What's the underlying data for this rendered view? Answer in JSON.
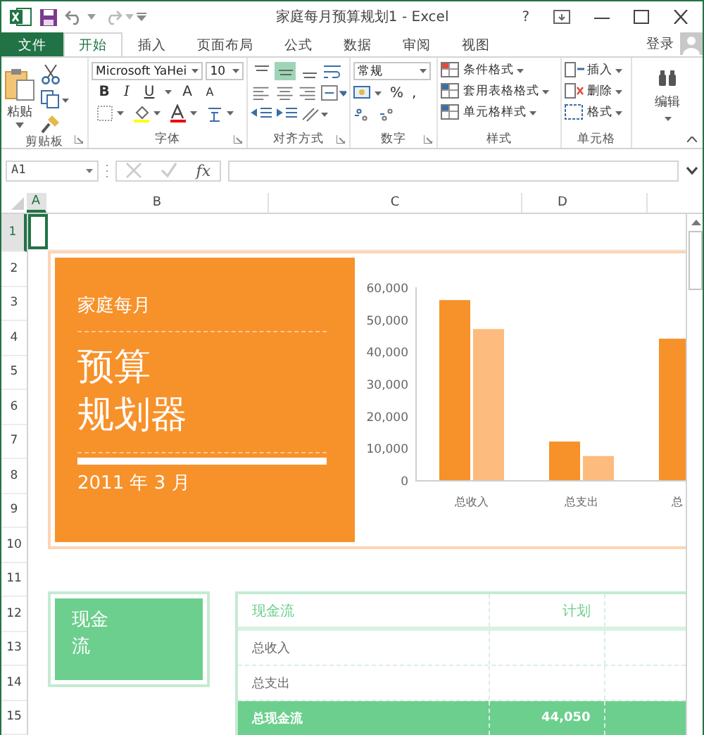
{
  "window": {
    "title": "家庭每月预算规划1 - Excel",
    "help": "?"
  },
  "tabs": [
    {
      "label": "文件",
      "kind": "file",
      "selected": false
    },
    {
      "label": "开始",
      "kind": "tab",
      "selected": true
    },
    {
      "label": "插入",
      "kind": "tab",
      "selected": false
    },
    {
      "label": "页面布局",
      "kind": "tab",
      "selected": false
    },
    {
      "label": "公式",
      "kind": "tab",
      "selected": false
    },
    {
      "label": "数据",
      "kind": "tab",
      "selected": false
    },
    {
      "label": "审阅",
      "kind": "tab",
      "selected": false
    },
    {
      "label": "视图",
      "kind": "tab",
      "selected": false
    }
  ],
  "account": "登录",
  "ribbon": {
    "paste": "粘贴",
    "font_name": "Microsoft YaHei",
    "font_size": "10",
    "font_buttons": [
      "B",
      "I",
      "U"
    ],
    "grow_shrink": [
      "A",
      "A"
    ],
    "vertical_align": [
      {
        "selected": false
      },
      {
        "selected": true
      },
      {
        "selected": false
      }
    ],
    "number_format": "常规",
    "number_symbols": [
      "%",
      ","
    ],
    "styles": [
      "条件格式",
      "套用表格格式",
      "单元格样式"
    ],
    "cells": [
      "插入",
      "删除",
      "格式"
    ],
    "edit": "编辑",
    "groups": [
      "剪贴板",
      "字体",
      "对齐方式",
      "数字",
      "样式",
      "单元格"
    ]
  },
  "formula_bar": {
    "name_box": "A1",
    "fx": "fx"
  },
  "columns": [
    {
      "label": "A",
      "selected": true
    },
    {
      "label": "B",
      "selected": false
    },
    {
      "label": "C",
      "selected": false
    },
    {
      "label": "D",
      "selected": false
    }
  ],
  "rows": [
    {
      "label": "1",
      "selected": true
    },
    {
      "label": "2",
      "selected": false
    },
    {
      "label": "3",
      "selected": false
    },
    {
      "label": "4",
      "selected": false
    },
    {
      "label": "5",
      "selected": false
    },
    {
      "label": "6",
      "selected": false
    },
    {
      "label": "7",
      "selected": false
    },
    {
      "label": "8",
      "selected": false
    },
    {
      "label": "9",
      "selected": false
    },
    {
      "label": "10",
      "selected": false
    },
    {
      "label": "11",
      "selected": false
    },
    {
      "label": "12",
      "selected": false
    },
    {
      "label": "13",
      "selected": false
    },
    {
      "label": "14",
      "selected": false
    },
    {
      "label": "15",
      "selected": false
    }
  ],
  "title_card": {
    "subtitle": "家庭每月",
    "title_lines": [
      "预算",
      "规划器"
    ],
    "date": "2011 年 3 月"
  },
  "chart_data": {
    "type": "bar",
    "categories": [
      "总收入",
      "总支出",
      "总"
    ],
    "series": [
      {
        "color": "#f7912a",
        "values": [
          56000,
          12000,
          44000
        ]
      },
      {
        "color": "#fdbb7d",
        "values": [
          47000,
          7500,
          null
        ]
      }
    ],
    "ylim": [
      0,
      60000
    ],
    "yticks": [
      {
        "value": 0,
        "label": "0"
      },
      {
        "value": 10000,
        "label": "10,000"
      },
      {
        "value": 20000,
        "label": "20,000"
      },
      {
        "value": 30000,
        "label": "30,000"
      },
      {
        "value": 40000,
        "label": "40,000"
      },
      {
        "value": 50000,
        "label": "50,000"
      },
      {
        "value": 60000,
        "label": "60,000"
      }
    ]
  },
  "cash_card": {
    "title_lines": [
      "现金",
      "流"
    ]
  },
  "cash_table": {
    "columns": [
      "现金流",
      "计划"
    ],
    "rows": [
      {
        "kind": "item",
        "label": "总收入"
      },
      {
        "kind": "item",
        "label": "总支出"
      },
      {
        "kind": "total",
        "label": "总现金流",
        "plan": "44,050"
      }
    ]
  }
}
